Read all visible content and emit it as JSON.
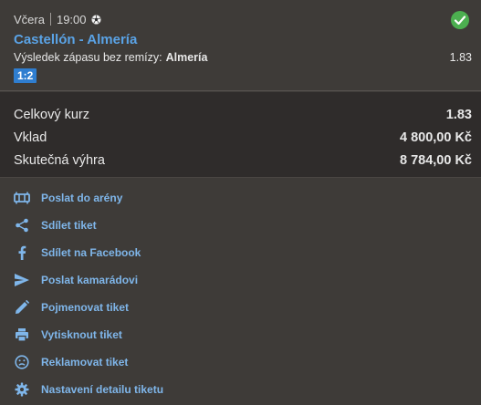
{
  "bet": {
    "day": "Včera",
    "time": "19:00",
    "sport_icon": "soccer-ball-icon",
    "status_icon": "check-circle-icon",
    "status_color": "#4caf50",
    "match": "Castellón - Almería",
    "market_label": "Výsledek zápasu bez remízy:",
    "selection": "Almería",
    "odds": "1.83",
    "score": "1:2"
  },
  "summary": {
    "total_odds_label": "Celkový kurz",
    "total_odds_value": "1.83",
    "stake_label": "Vklad",
    "stake_value": "4 800,00 Kč",
    "win_label": "Skutečná výhra",
    "win_value": "8 784,00 Kč"
  },
  "actions": [
    {
      "icon": "arena-icon",
      "label": "Poslat do arény"
    },
    {
      "icon": "share-icon",
      "label": "Sdílet tiket"
    },
    {
      "icon": "facebook-icon",
      "label": "Sdílet na Facebook"
    },
    {
      "icon": "send-icon",
      "label": "Poslat kamarádovi"
    },
    {
      "icon": "pencil-icon",
      "label": "Pojmenovat tiket"
    },
    {
      "icon": "printer-icon",
      "label": "Vytisknout tiket"
    },
    {
      "icon": "sad-face-icon",
      "label": "Reklamovat tiket"
    },
    {
      "icon": "gear-icon",
      "label": "Nastavení detailu tiketu"
    }
  ],
  "colors": {
    "link": "#7fb6ea",
    "match_title": "#5aa3e6",
    "badge": "#2f7ed0",
    "icon": "#7fb6ea"
  }
}
